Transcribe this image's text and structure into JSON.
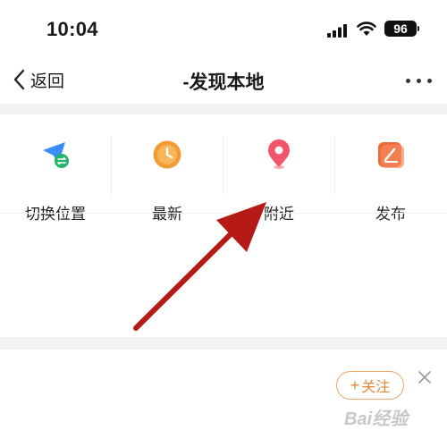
{
  "status": {
    "time": "10:04",
    "battery": "96"
  },
  "nav": {
    "back_label": "返回",
    "title": "-发现本地"
  },
  "shortcuts": [
    {
      "label": "切换位置",
      "icon": "location-switch-icon"
    },
    {
      "label": "最新",
      "icon": "clock-icon"
    },
    {
      "label": "附近",
      "icon": "map-pin-icon"
    },
    {
      "label": "发布",
      "icon": "edit-icon"
    }
  ],
  "follow": {
    "label": "关注"
  },
  "watermark": "Bai经验",
  "colors": {
    "accent": "#f07f22",
    "pin": "#f2546a",
    "arrow": "#b51a17",
    "follow": "#e08a3a"
  }
}
